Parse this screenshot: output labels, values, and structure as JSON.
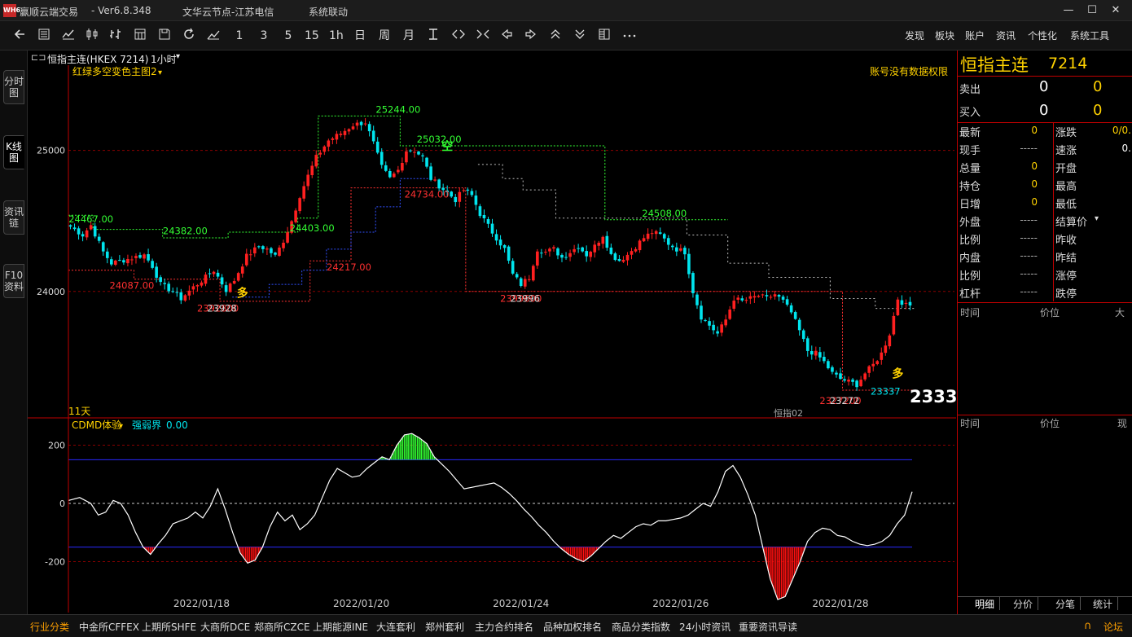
{
  "app": {
    "name": "赢顺云端交易",
    "version": "- Ver6.8.348",
    "node": "文华云节点-江苏电信",
    "menu_label": "系统联动",
    "logo_text": "WH6",
    "win_minimize": "—",
    "win_maximize": "☐",
    "win_close": "✕"
  },
  "toolbar": {
    "periods": [
      "1",
      "3",
      "5",
      "15",
      "1h",
      "日",
      "周",
      "月"
    ],
    "right_menu": [
      "发现",
      "板块",
      "账户",
      "资讯",
      "个性化",
      "系统工具"
    ]
  },
  "side_tabs": [
    "分时图",
    "K线图",
    "资讯链",
    "F10资料"
  ],
  "chart_header": {
    "title": "恒指主连(HKEX 7214)",
    "period": "1小时",
    "main_indicator": "红绿多空变色主图2",
    "permission_notice": "账号没有数据权限",
    "days_label": "11天",
    "watermark_label": "恒指02",
    "last_price_tag": "2333",
    "sub_indicator": "CDMD体验",
    "sub_value_label": "强弱界",
    "sub_value": "0.00"
  },
  "chart_data": [
    {
      "type": "candlestick",
      "title": "恒指主连(HKEX 7214) 1小时",
      "xlabel": "",
      "ylabel": "",
      "ylim": [
        23150,
        25500
      ],
      "y_ticks": [
        25000,
        24000
      ],
      "x_ticks": [
        "2022/01/18",
        "2022/01/20",
        "2022/01/24",
        "2022/01/26",
        "2022/01/28"
      ],
      "grid": true,
      "colors": {
        "up": "#ff2020",
        "down": "#00e5ee",
        "support": "#ff3030",
        "resistance": "#33ff33"
      },
      "close_trend": [
        [
          0,
          24460
        ],
        [
          3,
          24400
        ],
        [
          5,
          24470
        ],
        [
          8,
          24280
        ],
        [
          10,
          24200
        ],
        [
          14,
          24230
        ],
        [
          18,
          24260
        ],
        [
          20,
          24180
        ],
        [
          22,
          24050
        ],
        [
          25,
          24000
        ],
        [
          27,
          23950
        ],
        [
          30,
          24030
        ],
        [
          33,
          24100
        ],
        [
          35,
          24150
        ],
        [
          38,
          24010
        ],
        [
          40,
          24080
        ],
        [
          43,
          24250
        ],
        [
          46,
          24320
        ],
        [
          48,
          24300
        ],
        [
          50,
          24250
        ],
        [
          52,
          24360
        ],
        [
          54,
          24500
        ],
        [
          56,
          24680
        ],
        [
          58,
          24820
        ],
        [
          60,
          24950
        ],
        [
          63,
          25070
        ],
        [
          66,
          25120
        ],
        [
          69,
          25180
        ],
        [
          72,
          25200
        ],
        [
          74,
          25050
        ],
        [
          76,
          24880
        ],
        [
          78,
          24800
        ],
        [
          80,
          24860
        ],
        [
          82,
          25000
        ],
        [
          84,
          25000
        ],
        [
          86,
          24950
        ],
        [
          88,
          24800
        ],
        [
          90,
          24750
        ],
        [
          92,
          24700
        ],
        [
          94,
          24650
        ],
        [
          96,
          24720
        ],
        [
          98,
          24680
        ],
        [
          100,
          24550
        ],
        [
          103,
          24420
        ],
        [
          106,
          24300
        ],
        [
          108,
          24120
        ],
        [
          110,
          24050
        ],
        [
          112,
          24100
        ],
        [
          114,
          24300
        ],
        [
          116,
          24280
        ],
        [
          118,
          24300
        ],
        [
          120,
          24240
        ],
        [
          122,
          24280
        ],
        [
          124,
          24320
        ],
        [
          126,
          24260
        ],
        [
          128,
          24320
        ],
        [
          130,
          24400
        ],
        [
          132,
          24260
        ],
        [
          134,
          24220
        ],
        [
          136,
          24260
        ],
        [
          138,
          24320
        ],
        [
          140,
          24380
        ],
        [
          142,
          24420
        ],
        [
          144,
          24400
        ],
        [
          146,
          24340
        ],
        [
          148,
          24300
        ],
        [
          150,
          24280
        ],
        [
          152,
          24000
        ],
        [
          154,
          23820
        ],
        [
          156,
          23760
        ],
        [
          158,
          23700
        ],
        [
          160,
          23800
        ],
        [
          162,
          23950
        ],
        [
          164,
          23930
        ],
        [
          166,
          23950
        ],
        [
          168,
          23970
        ],
        [
          170,
          23950
        ],
        [
          172,
          23980
        ],
        [
          174,
          23930
        ],
        [
          176,
          23850
        ],
        [
          178,
          23720
        ],
        [
          180,
          23580
        ],
        [
          182,
          23560
        ],
        [
          184,
          23500
        ],
        [
          186,
          23420
        ],
        [
          188,
          23380
        ],
        [
          190,
          23360
        ],
        [
          192,
          23340
        ],
        [
          194,
          23420
        ],
        [
          196,
          23480
        ],
        [
          198,
          23560
        ],
        [
          200,
          23700
        ],
        [
          202,
          23950
        ],
        [
          204,
          23900
        ]
      ],
      "labels": [
        {
          "text": "24467.00",
          "type": "high",
          "value": 24467,
          "index": 5
        },
        {
          "text": "24382.00",
          "type": "high",
          "value": 24382,
          "index": 28
        },
        {
          "text": "24087.00",
          "type": "low",
          "value": 24087,
          "index": 15
        },
        {
          "text": "2392800",
          "type": "low",
          "value": 23928,
          "index": 36
        },
        {
          "text": "23928",
          "type": "low",
          "value": 23928,
          "index": 37
        },
        {
          "text": "24403.00",
          "type": "high",
          "value": 24403,
          "index": 59
        },
        {
          "text": "24217.00",
          "type": "low",
          "value": 24217,
          "index": 68
        },
        {
          "text": "25244.00",
          "type": "high",
          "value": 25244,
          "index": 80
        },
        {
          "text": "25032.00",
          "type": "high",
          "value": 25032,
          "index": 90
        },
        {
          "text": "24734.00",
          "type": "low",
          "value": 24734,
          "index": 87
        },
        {
          "text": "2399600",
          "type": "low",
          "value": 23996,
          "index": 110
        },
        {
          "text": "23996",
          "type": "low",
          "value": 23996,
          "index": 111
        },
        {
          "text": "24508.00",
          "type": "high",
          "value": 24508,
          "index": 145
        },
        {
          "text": "2327200",
          "type": "low",
          "value": 23272,
          "index": 188
        },
        {
          "text": "23272",
          "type": "low",
          "value": 23272,
          "index": 189
        },
        {
          "text": "23337",
          "type": "low",
          "value": 23337,
          "index": 199
        }
      ],
      "signals": [
        {
          "text": "多",
          "index": 42,
          "value": 23960
        },
        {
          "text": "空",
          "index": 92,
          "value": 25000
        },
        {
          "text": "多",
          "index": 202,
          "value": 23390
        }
      ]
    },
    {
      "type": "line",
      "title": "CDMD体验",
      "series": [
        {
          "name": "强弱界",
          "values": [
            0
          ]
        }
      ],
      "ylim": [
        -330,
        260
      ],
      "y_ticks": [
        200,
        0,
        -200
      ],
      "bands": [
        150,
        -150
      ],
      "grid": true,
      "line_points": [
        [
          0,
          10
        ],
        [
          3,
          20
        ],
        [
          6,
          0
        ],
        [
          8,
          -40
        ],
        [
          10,
          -30
        ],
        [
          12,
          10
        ],
        [
          14,
          0
        ],
        [
          16,
          -40
        ],
        [
          18,
          -100
        ],
        [
          20,
          -150
        ],
        [
          22,
          -175
        ],
        [
          24,
          -140
        ],
        [
          26,
          -110
        ],
        [
          28,
          -70
        ],
        [
          30,
          -60
        ],
        [
          32,
          -50
        ],
        [
          34,
          -30
        ],
        [
          36,
          -50
        ],
        [
          38,
          -10
        ],
        [
          40,
          50
        ],
        [
          42,
          -20
        ],
        [
          44,
          -100
        ],
        [
          46,
          -170
        ],
        [
          48,
          -205
        ],
        [
          50,
          -195
        ],
        [
          52,
          -150
        ],
        [
          54,
          -80
        ],
        [
          56,
          -30
        ],
        [
          58,
          -60
        ],
        [
          60,
          -40
        ],
        [
          62,
          -90
        ],
        [
          64,
          -70
        ],
        [
          66,
          -40
        ],
        [
          68,
          20
        ],
        [
          70,
          80
        ],
        [
          72,
          120
        ],
        [
          74,
          105
        ],
        [
          76,
          90
        ],
        [
          78,
          95
        ],
        [
          80,
          120
        ],
        [
          82,
          140
        ],
        [
          84,
          160
        ],
        [
          86,
          150
        ],
        [
          88,
          200
        ],
        [
          90,
          235
        ],
        [
          92,
          240
        ],
        [
          94,
          225
        ],
        [
          96,
          205
        ],
        [
          98,
          160
        ],
        [
          100,
          135
        ],
        [
          102,
          110
        ],
        [
          104,
          80
        ],
        [
          106,
          50
        ],
        [
          108,
          55
        ],
        [
          110,
          60
        ],
        [
          112,
          65
        ],
        [
          114,
          70
        ],
        [
          116,
          55
        ],
        [
          118,
          35
        ],
        [
          120,
          10
        ],
        [
          122,
          -20
        ],
        [
          124,
          -45
        ],
        [
          126,
          -75
        ],
        [
          128,
          -100
        ],
        [
          130,
          -130
        ],
        [
          132,
          -155
        ],
        [
          134,
          -175
        ],
        [
          136,
          -190
        ],
        [
          138,
          -200
        ],
        [
          140,
          -180
        ],
        [
          142,
          -155
        ],
        [
          144,
          -130
        ],
        [
          146,
          -110
        ],
        [
          148,
          -120
        ],
        [
          150,
          -100
        ],
        [
          152,
          -80
        ],
        [
          154,
          -70
        ],
        [
          156,
          -75
        ],
        [
          158,
          -60
        ],
        [
          160,
          -60
        ],
        [
          162,
          -55
        ],
        [
          164,
          -50
        ],
        [
          166,
          -40
        ],
        [
          168,
          -20
        ],
        [
          170,
          0
        ],
        [
          172,
          -10
        ],
        [
          174,
          40
        ],
        [
          176,
          110
        ],
        [
          178,
          130
        ],
        [
          180,
          90
        ],
        [
          182,
          30
        ],
        [
          184,
          -40
        ],
        [
          186,
          -150
        ],
        [
          188,
          -260
        ],
        [
          190,
          -330
        ],
        [
          192,
          -320
        ],
        [
          194,
          -260
        ],
        [
          196,
          -200
        ],
        [
          198,
          -130
        ],
        [
          200,
          -100
        ],
        [
          202,
          -85
        ],
        [
          204,
          -90
        ],
        [
          206,
          -110
        ],
        [
          208,
          -115
        ],
        [
          210,
          -130
        ],
        [
          212,
          -140
        ],
        [
          214,
          -145
        ],
        [
          216,
          -140
        ],
        [
          218,
          -130
        ],
        [
          220,
          -110
        ],
        [
          222,
          -70
        ],
        [
          224,
          -40
        ],
        [
          226,
          40
        ]
      ]
    }
  ],
  "quote_panel": {
    "name": "恒指主连",
    "code": "7214",
    "sell_label": "卖出",
    "buy_label": "买入",
    "sell_price": "0",
    "sell_vol": "0",
    "buy_price": "0",
    "buy_vol": "0",
    "rows": [
      {
        "k1": "最新",
        "v1": "0",
        "k2": "涨跌",
        "v2": "0/0."
      },
      {
        "k1": "现手",
        "v1": "-----",
        "k2": "速涨",
        "v2": "0."
      },
      {
        "k1": "总量",
        "v1": "0",
        "k2": "开盘",
        "v2": ""
      },
      {
        "k1": "持仓",
        "v1": "0",
        "k2": "最高",
        "v2": ""
      },
      {
        "k1": "日增",
        "v1": "0",
        "k2": "最低",
        "v2": ""
      },
      {
        "k1": "外盘",
        "v1": "-----",
        "k2": "结算价",
        "v2": ""
      },
      {
        "k1": "比例",
        "v1": "-----",
        "k2": "昨收",
        "v2": ""
      },
      {
        "k1": "内盘",
        "v1": "-----",
        "k2": "昨结",
        "v2": ""
      },
      {
        "k1": "比例",
        "v1": "-----",
        "k2": "涨停",
        "v2": ""
      },
      {
        "k1": "杠杆",
        "v1": "-----",
        "k2": "跌停",
        "v2": ""
      }
    ],
    "tick_header_1": [
      "时间",
      "价位",
      "大"
    ],
    "tick_header_2": [
      "时间",
      "价位",
      "现"
    ],
    "bottom_tabs": [
      "明细",
      "分价",
      "分笔",
      "统计"
    ]
  },
  "bottom_bar": {
    "active": "行业分类",
    "items": [
      "中金所CFFEX",
      "上期所SHFE",
      "大商所DCE",
      "郑商所CZCE",
      "上期能源INE",
      "大连套利",
      "郑州套利",
      "主力合约排名",
      "品种加权排名",
      "商品分类指数",
      "24小时资讯",
      "重要资讯导读"
    ],
    "forum_label": "论坛"
  }
}
